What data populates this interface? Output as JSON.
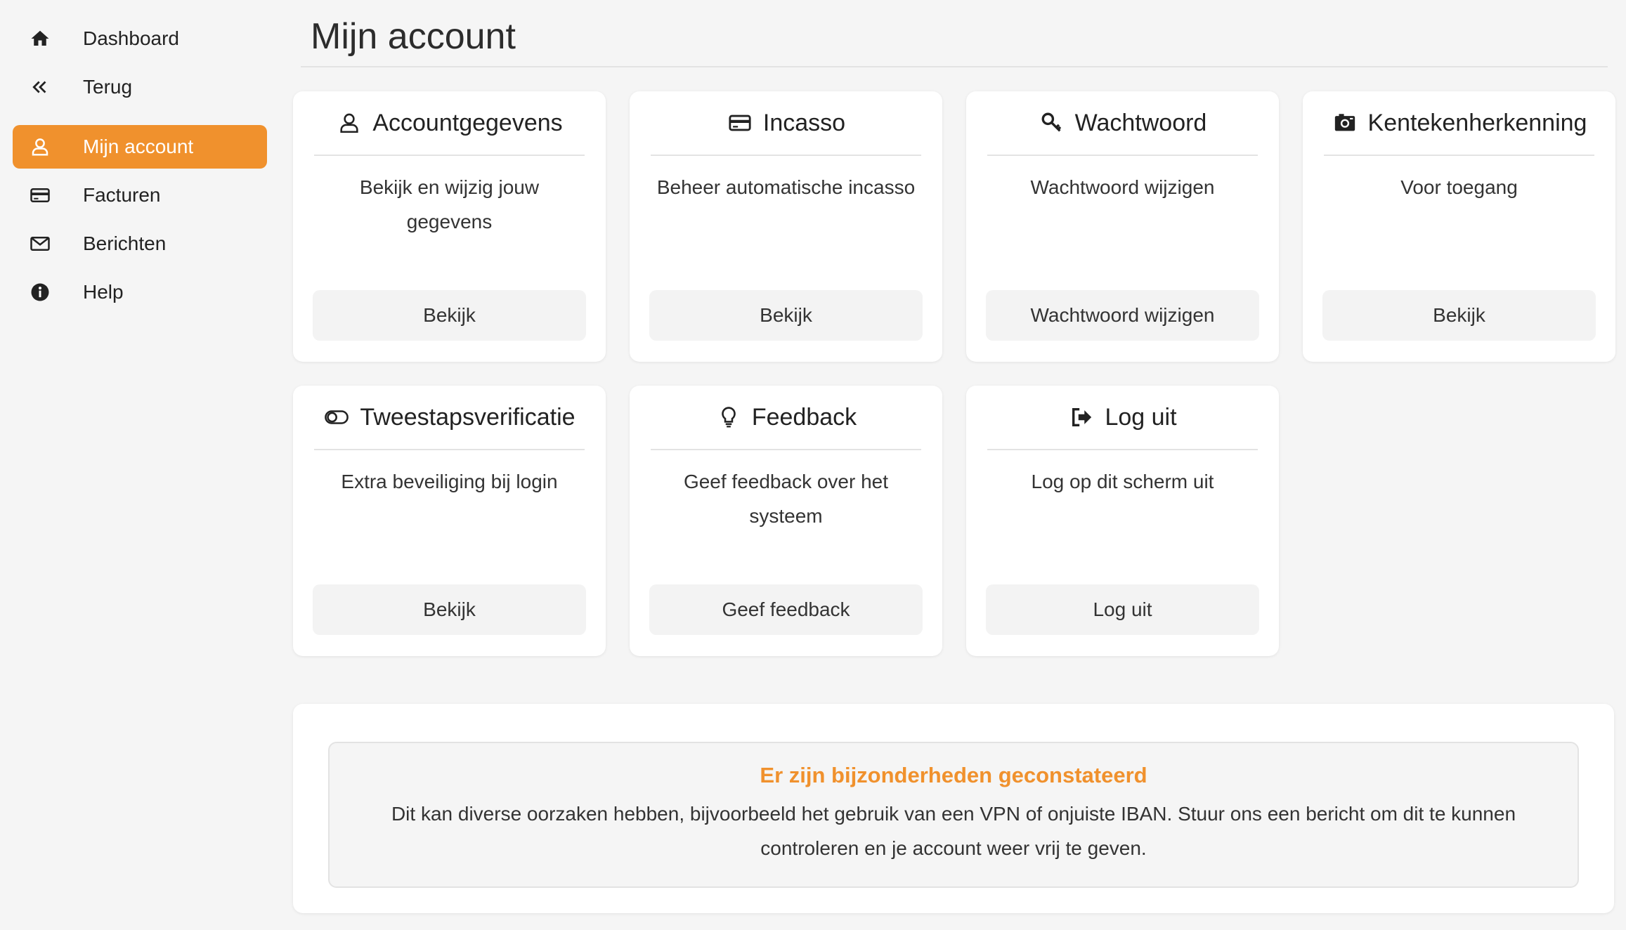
{
  "sidebar": {
    "items": [
      {
        "label": "Dashboard",
        "icon": "home-icon",
        "active": false
      },
      {
        "label": "Terug",
        "icon": "double-chevron-left-icon",
        "active": false
      },
      {
        "label": "Mijn account",
        "icon": "user-icon",
        "active": true
      },
      {
        "label": "Facturen",
        "icon": "credit-card-icon",
        "active": false
      },
      {
        "label": "Berichten",
        "icon": "envelope-icon",
        "active": false
      },
      {
        "label": "Help",
        "icon": "info-circle-icon",
        "active": false
      }
    ]
  },
  "page": {
    "title": "Mijn account"
  },
  "cards": [
    {
      "title": "Accountgegevens",
      "icon": "user-icon",
      "description": "Bekijk en wijzig jouw gegevens",
      "button": "Bekijk"
    },
    {
      "title": "Incasso",
      "icon": "credit-card-icon",
      "description": "Beheer automatische incasso",
      "button": "Bekijk"
    },
    {
      "title": "Wachtwoord",
      "icon": "key-icon",
      "description": "Wachtwoord wijzigen",
      "button": "Wachtwoord wijzigen"
    },
    {
      "title": "Kentekenherkenning",
      "icon": "camera-icon",
      "description": "Voor toegang",
      "button": "Bekijk"
    },
    {
      "title": "Tweestapsverificatie",
      "icon": "toggle-icon",
      "description": "Extra beveiliging bij login",
      "button": "Bekijk"
    },
    {
      "title": "Feedback",
      "icon": "lightbulb-icon",
      "description": "Geef feedback over het systeem",
      "button": "Geef feedback"
    },
    {
      "title": "Log uit",
      "icon": "sign-out-icon",
      "description": "Log op dit scherm uit",
      "button": "Log uit"
    }
  ],
  "notice": {
    "title": "Er zijn bijzonderheden geconstateerd",
    "text": "Dit kan diverse oorzaken hebben, bijvoorbeeld het gebruik van een VPN of onjuiste IBAN. Stuur ons een bericht om dit te kunnen controleren en je account weer vrij te geven."
  },
  "colors": {
    "accent": "#f0912d",
    "background": "#f5f5f5",
    "card": "#ffffff"
  }
}
